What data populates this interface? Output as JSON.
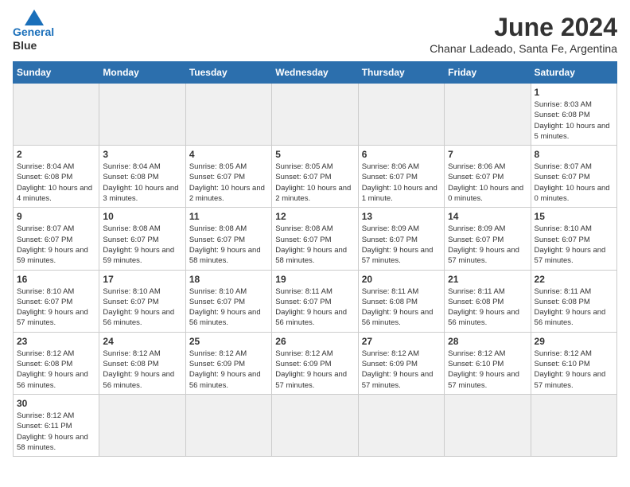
{
  "header": {
    "logo_line1": "General",
    "logo_line2": "Blue",
    "month_title": "June 2024",
    "subtitle": "Chanar Ladeado, Santa Fe, Argentina"
  },
  "weekdays": [
    "Sunday",
    "Monday",
    "Tuesday",
    "Wednesday",
    "Thursday",
    "Friday",
    "Saturday"
  ],
  "days": [
    {
      "num": "",
      "empty": true
    },
    {
      "num": "",
      "empty": true
    },
    {
      "num": "",
      "empty": true
    },
    {
      "num": "",
      "empty": true
    },
    {
      "num": "",
      "empty": true
    },
    {
      "num": "",
      "empty": true
    },
    {
      "num": "1",
      "sunrise": "Sunrise: 8:03 AM",
      "sunset": "Sunset: 6:08 PM",
      "daylight": "Daylight: 10 hours and 5 minutes."
    },
    {
      "num": "2",
      "sunrise": "Sunrise: 8:04 AM",
      "sunset": "Sunset: 6:08 PM",
      "daylight": "Daylight: 10 hours and 4 minutes."
    },
    {
      "num": "3",
      "sunrise": "Sunrise: 8:04 AM",
      "sunset": "Sunset: 6:08 PM",
      "daylight": "Daylight: 10 hours and 3 minutes."
    },
    {
      "num": "4",
      "sunrise": "Sunrise: 8:05 AM",
      "sunset": "Sunset: 6:07 PM",
      "daylight": "Daylight: 10 hours and 2 minutes."
    },
    {
      "num": "5",
      "sunrise": "Sunrise: 8:05 AM",
      "sunset": "Sunset: 6:07 PM",
      "daylight": "Daylight: 10 hours and 2 minutes."
    },
    {
      "num": "6",
      "sunrise": "Sunrise: 8:06 AM",
      "sunset": "Sunset: 6:07 PM",
      "daylight": "Daylight: 10 hours and 1 minute."
    },
    {
      "num": "7",
      "sunrise": "Sunrise: 8:06 AM",
      "sunset": "Sunset: 6:07 PM",
      "daylight": "Daylight: 10 hours and 0 minutes."
    },
    {
      "num": "8",
      "sunrise": "Sunrise: 8:07 AM",
      "sunset": "Sunset: 6:07 PM",
      "daylight": "Daylight: 10 hours and 0 minutes."
    },
    {
      "num": "9",
      "sunrise": "Sunrise: 8:07 AM",
      "sunset": "Sunset: 6:07 PM",
      "daylight": "Daylight: 9 hours and 59 minutes."
    },
    {
      "num": "10",
      "sunrise": "Sunrise: 8:08 AM",
      "sunset": "Sunset: 6:07 PM",
      "daylight": "Daylight: 9 hours and 59 minutes."
    },
    {
      "num": "11",
      "sunrise": "Sunrise: 8:08 AM",
      "sunset": "Sunset: 6:07 PM",
      "daylight": "Daylight: 9 hours and 58 minutes."
    },
    {
      "num": "12",
      "sunrise": "Sunrise: 8:08 AM",
      "sunset": "Sunset: 6:07 PM",
      "daylight": "Daylight: 9 hours and 58 minutes."
    },
    {
      "num": "13",
      "sunrise": "Sunrise: 8:09 AM",
      "sunset": "Sunset: 6:07 PM",
      "daylight": "Daylight: 9 hours and 57 minutes."
    },
    {
      "num": "14",
      "sunrise": "Sunrise: 8:09 AM",
      "sunset": "Sunset: 6:07 PM",
      "daylight": "Daylight: 9 hours and 57 minutes."
    },
    {
      "num": "15",
      "sunrise": "Sunrise: 8:10 AM",
      "sunset": "Sunset: 6:07 PM",
      "daylight": "Daylight: 9 hours and 57 minutes."
    },
    {
      "num": "16",
      "sunrise": "Sunrise: 8:10 AM",
      "sunset": "Sunset: 6:07 PM",
      "daylight": "Daylight: 9 hours and 57 minutes."
    },
    {
      "num": "17",
      "sunrise": "Sunrise: 8:10 AM",
      "sunset": "Sunset: 6:07 PM",
      "daylight": "Daylight: 9 hours and 56 minutes."
    },
    {
      "num": "18",
      "sunrise": "Sunrise: 8:10 AM",
      "sunset": "Sunset: 6:07 PM",
      "daylight": "Daylight: 9 hours and 56 minutes."
    },
    {
      "num": "19",
      "sunrise": "Sunrise: 8:11 AM",
      "sunset": "Sunset: 6:07 PM",
      "daylight": "Daylight: 9 hours and 56 minutes."
    },
    {
      "num": "20",
      "sunrise": "Sunrise: 8:11 AM",
      "sunset": "Sunset: 6:08 PM",
      "daylight": "Daylight: 9 hours and 56 minutes."
    },
    {
      "num": "21",
      "sunrise": "Sunrise: 8:11 AM",
      "sunset": "Sunset: 6:08 PM",
      "daylight": "Daylight: 9 hours and 56 minutes."
    },
    {
      "num": "22",
      "sunrise": "Sunrise: 8:11 AM",
      "sunset": "Sunset: 6:08 PM",
      "daylight": "Daylight: 9 hours and 56 minutes."
    },
    {
      "num": "23",
      "sunrise": "Sunrise: 8:12 AM",
      "sunset": "Sunset: 6:08 PM",
      "daylight": "Daylight: 9 hours and 56 minutes."
    },
    {
      "num": "24",
      "sunrise": "Sunrise: 8:12 AM",
      "sunset": "Sunset: 6:08 PM",
      "daylight": "Daylight: 9 hours and 56 minutes."
    },
    {
      "num": "25",
      "sunrise": "Sunrise: 8:12 AM",
      "sunset": "Sunset: 6:09 PM",
      "daylight": "Daylight: 9 hours and 56 minutes."
    },
    {
      "num": "26",
      "sunrise": "Sunrise: 8:12 AM",
      "sunset": "Sunset: 6:09 PM",
      "daylight": "Daylight: 9 hours and 57 minutes."
    },
    {
      "num": "27",
      "sunrise": "Sunrise: 8:12 AM",
      "sunset": "Sunset: 6:09 PM",
      "daylight": "Daylight: 9 hours and 57 minutes."
    },
    {
      "num": "28",
      "sunrise": "Sunrise: 8:12 AM",
      "sunset": "Sunset: 6:10 PM",
      "daylight": "Daylight: 9 hours and 57 minutes."
    },
    {
      "num": "29",
      "sunrise": "Sunrise: 8:12 AM",
      "sunset": "Sunset: 6:10 PM",
      "daylight": "Daylight: 9 hours and 57 minutes."
    },
    {
      "num": "30",
      "sunrise": "Sunrise: 8:12 AM",
      "sunset": "Sunset: 6:11 PM",
      "daylight": "Daylight: 9 hours and 58 minutes."
    },
    {
      "num": "",
      "empty": true
    },
    {
      "num": "",
      "empty": true
    },
    {
      "num": "",
      "empty": true
    },
    {
      "num": "",
      "empty": true
    },
    {
      "num": "",
      "empty": true
    },
    {
      "num": "",
      "empty": true
    }
  ]
}
